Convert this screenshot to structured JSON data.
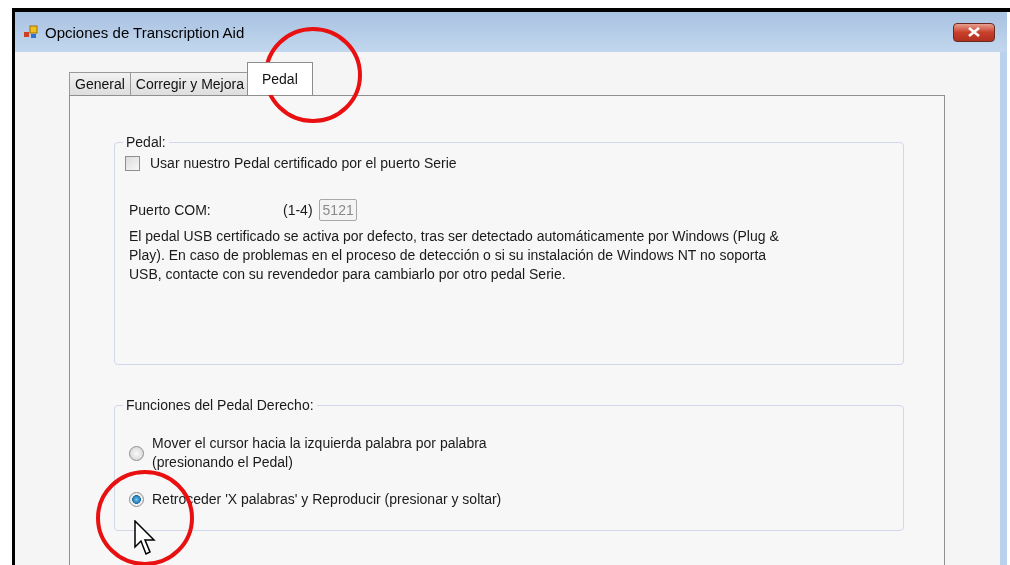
{
  "window": {
    "title": "Opciones de Transcription Aid"
  },
  "tabs": [
    {
      "label": "General",
      "selected": false
    },
    {
      "label": "Corregir y Mejora",
      "selected": false
    },
    {
      "label": "Pedal",
      "selected": true
    }
  ],
  "pedal_group": {
    "title": "Pedal:",
    "checkbox": {
      "label": "Usar nuestro Pedal certificado por el puerto Serie",
      "checked": false
    },
    "port": {
      "label": "Puerto COM:",
      "range": "(1-4)",
      "value": "5121",
      "disabled": true
    },
    "description_lines": [
      "El pedal USB certificado se activa por defecto, tras ser detectado automáticamente por Windows (Plug &",
      "Play). En caso de problemas en el proceso de detección o si su instalación de Windows NT no soporta",
      "USB, contacte con su revendedor para cambiarlo por otro pedal Serie."
    ]
  },
  "right_pedal_group": {
    "title": "Funciones del Pedal Derecho:",
    "options": [
      {
        "lines": [
          "Mover el cursor hacia la izquierda palabra por palabra",
          "(presionando el Pedal)"
        ],
        "selected": false
      },
      {
        "lines": [
          "Retroceder 'X palabras' y Reproducir (presionar y soltar)"
        ],
        "selected": true
      }
    ]
  }
}
